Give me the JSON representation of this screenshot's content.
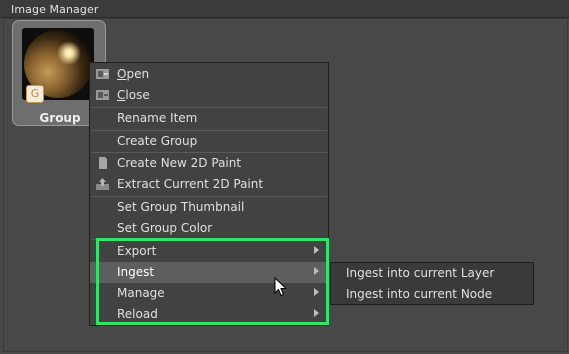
{
  "panel": {
    "title": "Image Manager"
  },
  "tile": {
    "label": "Group",
    "badge": "G"
  },
  "menu": {
    "items": [
      {
        "label": "Open",
        "icon": "open-icon"
      },
      {
        "label": "Close",
        "icon": "close-icon"
      },
      {
        "label": "Rename Item"
      },
      {
        "label": "Create Group"
      },
      {
        "label": "Create New 2D Paint",
        "icon": "document-icon"
      },
      {
        "label": "Extract Current 2D Paint",
        "icon": "extract-icon"
      },
      {
        "label": "Set Group Thumbnail"
      },
      {
        "label": "Set Group Color"
      },
      {
        "label": "Export",
        "submenu": true
      },
      {
        "label": "Ingest",
        "submenu": true,
        "highlighted": true
      },
      {
        "label": "Manage",
        "submenu": true
      },
      {
        "label": "Reload",
        "submenu": true
      }
    ]
  },
  "submenu": {
    "items": [
      {
        "label": "Ingest into current Layer"
      },
      {
        "label": "Ingest into current Node"
      }
    ]
  },
  "colors": {
    "highlight_box": "#2ee56b",
    "menu_bg": "#424242",
    "hover_bg": "#5e5e5e"
  }
}
